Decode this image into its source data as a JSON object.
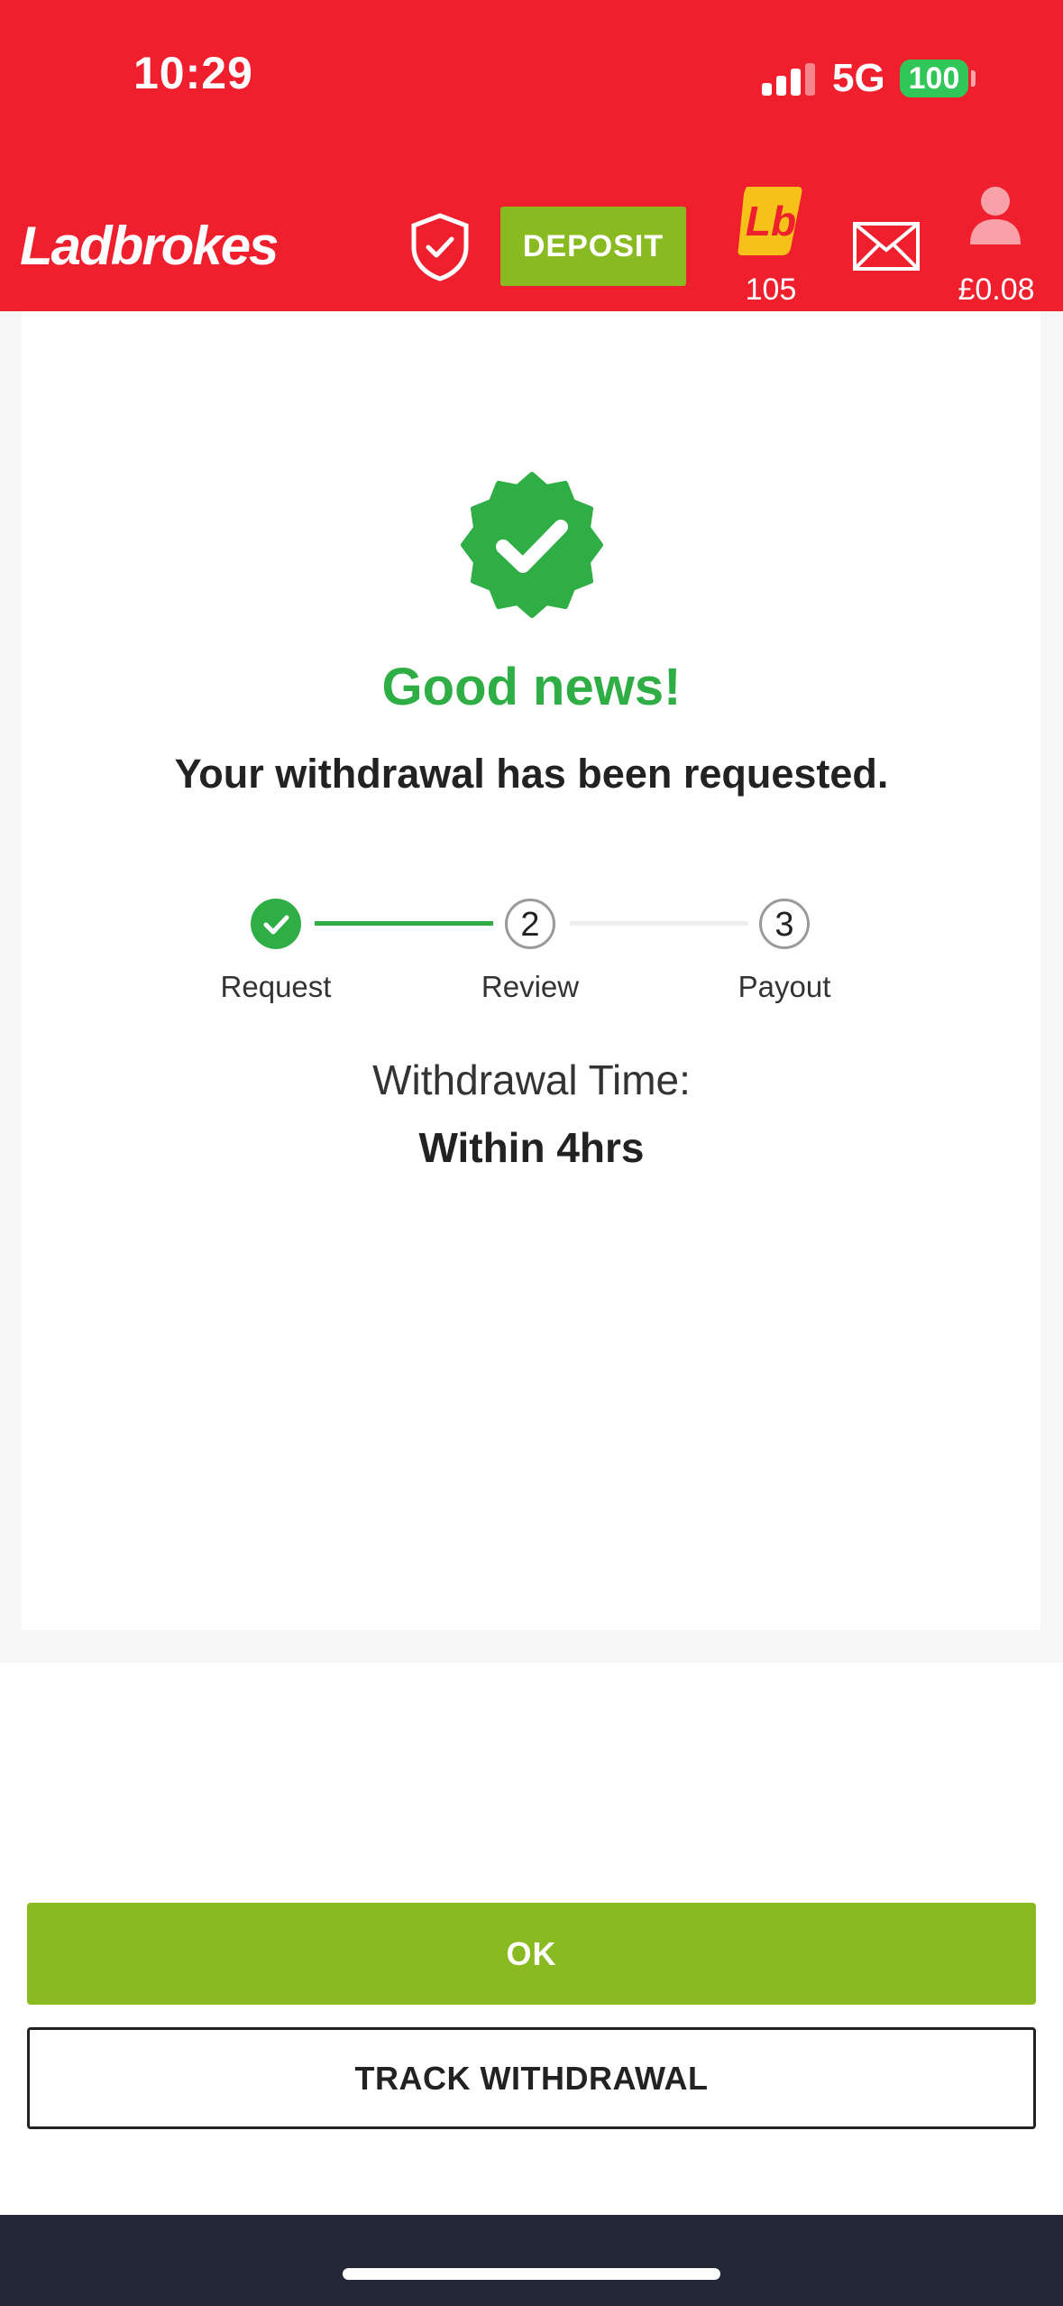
{
  "status_bar": {
    "time": "10:29",
    "network": "5G",
    "battery": "100"
  },
  "header": {
    "logo": "Ladbrokes",
    "deposit_label": "DEPOSIT",
    "rewards_count": "105",
    "balance": "£0.08"
  },
  "confirmation": {
    "headline": "Good news!",
    "message": "Your withdrawal has been requested."
  },
  "steps": [
    {
      "number": "1",
      "label": "Request",
      "status": "done"
    },
    {
      "number": "2",
      "label": "Review",
      "status": "pending"
    },
    {
      "number": "3",
      "label": "Payout",
      "status": "pending"
    }
  ],
  "withdrawal_time": {
    "label": "Withdrawal Time:",
    "value": "Within 4hrs"
  },
  "actions": {
    "ok_label": "OK",
    "track_label": "TRACK WITHDRAWAL"
  },
  "colors": {
    "brand_red": "#ef1f2e",
    "deposit_green": "#8aba22",
    "success_green": "#2fae45",
    "footer": "#232736"
  }
}
